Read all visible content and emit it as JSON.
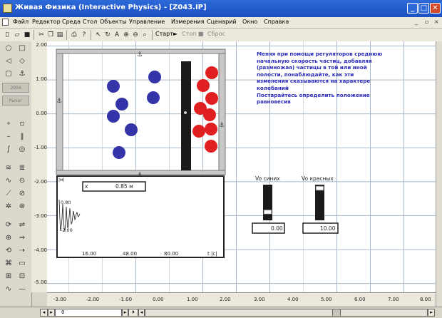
{
  "window": {
    "title": "Живая Физика (Interactive Physics) - [Z043.IP]"
  },
  "menu": [
    "Файл",
    "Редактор",
    "Среда",
    "Стол",
    "Объекты",
    "Управление",
    "Измерения",
    "Сценарий",
    "Окно",
    "Справка"
  ],
  "window_controls": {
    "min": "_",
    "max": "□",
    "close": "✕",
    "doc_min": "_",
    "doc_restore": "▫",
    "doc_close": "×"
  },
  "toolbar": {
    "start": "Старт►",
    "stop": "Стоп ■",
    "reset": "Сброс"
  },
  "palette_boxes": [
    "2004",
    "Рычаг"
  ],
  "canvas": {
    "description": "Меняя при помощи регуляторов среднюю\nначальную скорость частиц, добавляя\n(размножая) частицы в той или иной\nполости, понаблюдайте, как эти\nизменения сказываются на характере\nколебаний\nПостарайтесь определить положение\nравновесия",
    "chart": {
      "readout_label": "x",
      "readout_value": "0.85 м",
      "corner": "|м|",
      "y_top": "0.80",
      "y_bottom": "-2.00",
      "x_ticks": [
        "16.00",
        "48.00",
        "80.00"
      ],
      "x_unit": "t |c|"
    },
    "slider_blue": {
      "label": "Vo синих",
      "value": "0.00",
      "level": 0.1
    },
    "slider_red": {
      "label": "Vo красных",
      "value": "10.00",
      "level": 1.0
    }
  },
  "vruler_ticks": [
    "2.00",
    "1.00",
    "0.00",
    "-1.00",
    "-2.00",
    "-3.00",
    "-4.00",
    "-5.00"
  ],
  "hruler_ticks": [
    "-3.00",
    "-2.00",
    "-1.00",
    "0.00",
    "1.00",
    "2.00",
    "3.00",
    "4.00",
    "5.00",
    "6.00",
    "7.00",
    "8.00"
  ],
  "scroll": {
    "frame": "0"
  },
  "colors": {
    "blue": "#3434a8",
    "red": "#e02020",
    "titlebar": "#1f56c8",
    "text_blue": "#2a2ab8"
  }
}
